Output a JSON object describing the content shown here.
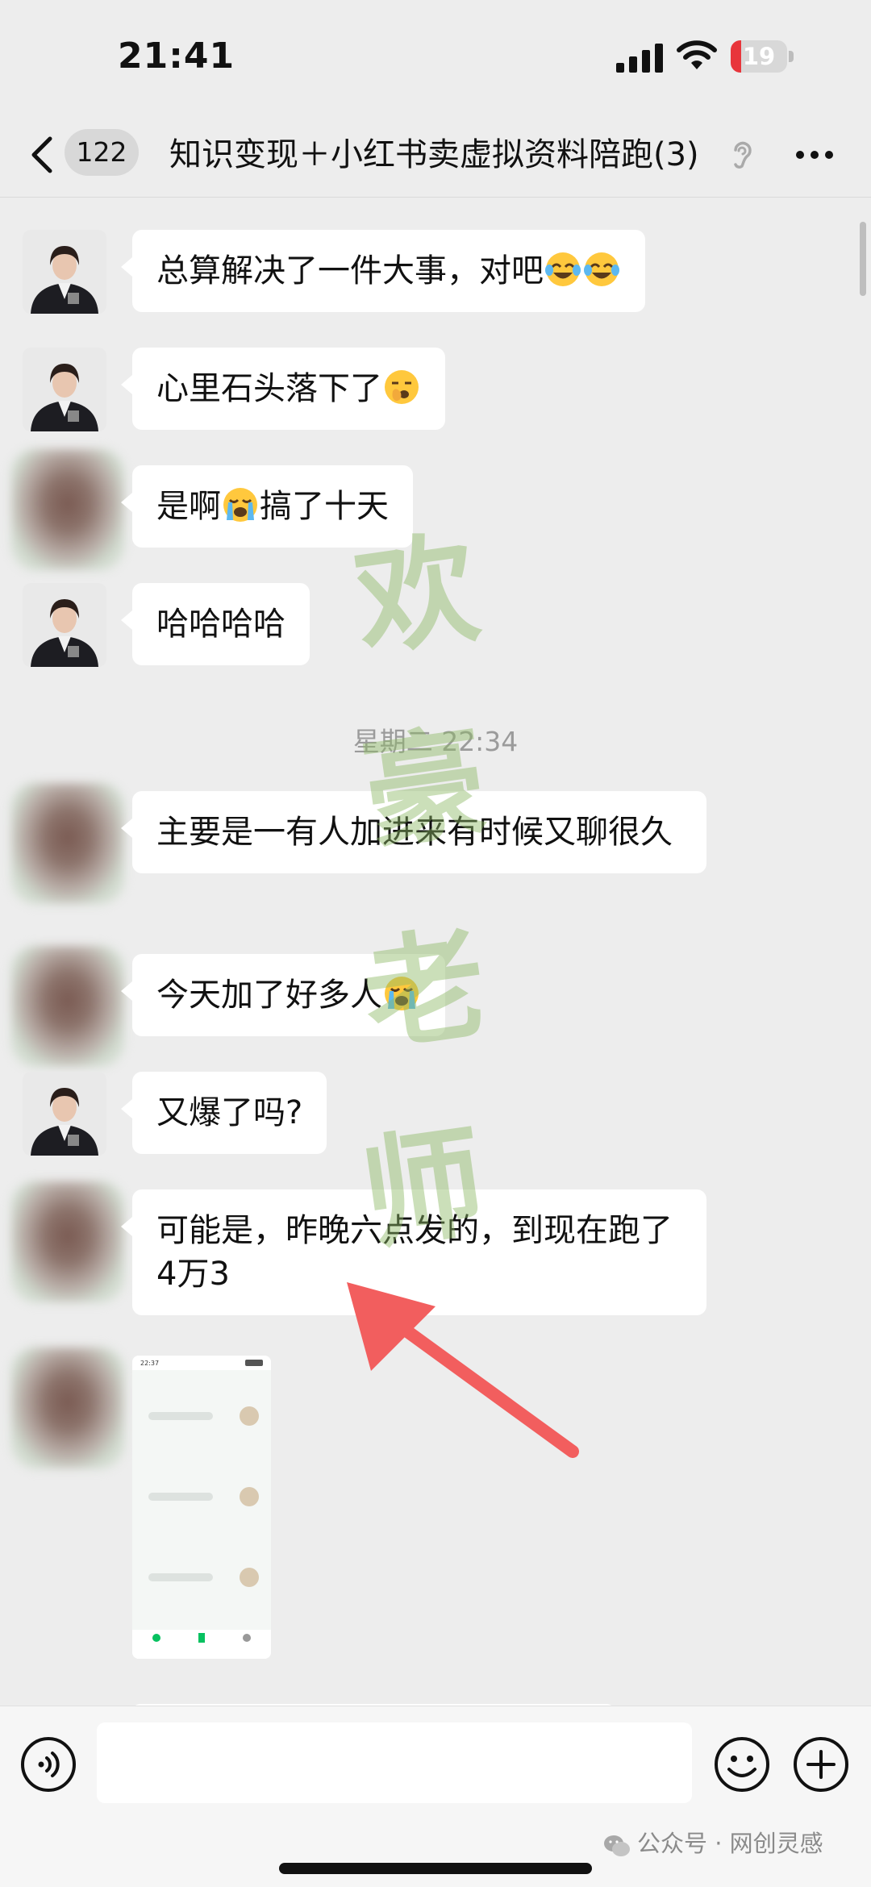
{
  "status_bar": {
    "time": "21:41",
    "battery": "19",
    "battery_level": 0.19
  },
  "nav": {
    "unread_count": "122",
    "title": "知识变现＋小红书卖虚拟资料陪跑",
    "member_count": "(3)",
    "colors": {
      "background": "#EDEDED"
    }
  },
  "messages": [
    {
      "text": "总算解决了一件大事，对吧",
      "emoji": [
        "laughing-crying-emoji",
        "laughing-crying-emoji"
      ],
      "sender": "teacher"
    },
    {
      "text": "心里石头落下了",
      "emoji": [
        "yawning-emoji"
      ],
      "sender": "teacher"
    },
    {
      "text": "是啊",
      "after": "搞了十天",
      "emoji": [
        "loudly-crying-emoji"
      ],
      "sender": "student"
    },
    {
      "text": "哈哈哈哈",
      "sender": "teacher"
    },
    {
      "text": "主要是一有人加进来有时候又聊很久",
      "sender": "student"
    },
    {
      "text": "今天加了好多人",
      "emoji": [
        "loudly-crying-emoji"
      ],
      "sender": "student"
    },
    {
      "text": "又爆了吗?",
      "sender": "teacher"
    },
    {
      "text": "可能是，昨晚六点发的，到现在跑了4万3",
      "sender": "student"
    }
  ],
  "timestamp": "星期二 22:34",
  "image_message": {
    "time": "22:37"
  },
  "watermark": [
    "欢",
    "豪",
    "老",
    "师"
  ],
  "footer": {
    "source": "公众号 · 网创灵感"
  },
  "colors": {
    "accent_arrow": "#F25E5E",
    "bubble": "#FFFFFF",
    "chat_bg": "#EDEDED",
    "watermark": "#8CB964"
  }
}
